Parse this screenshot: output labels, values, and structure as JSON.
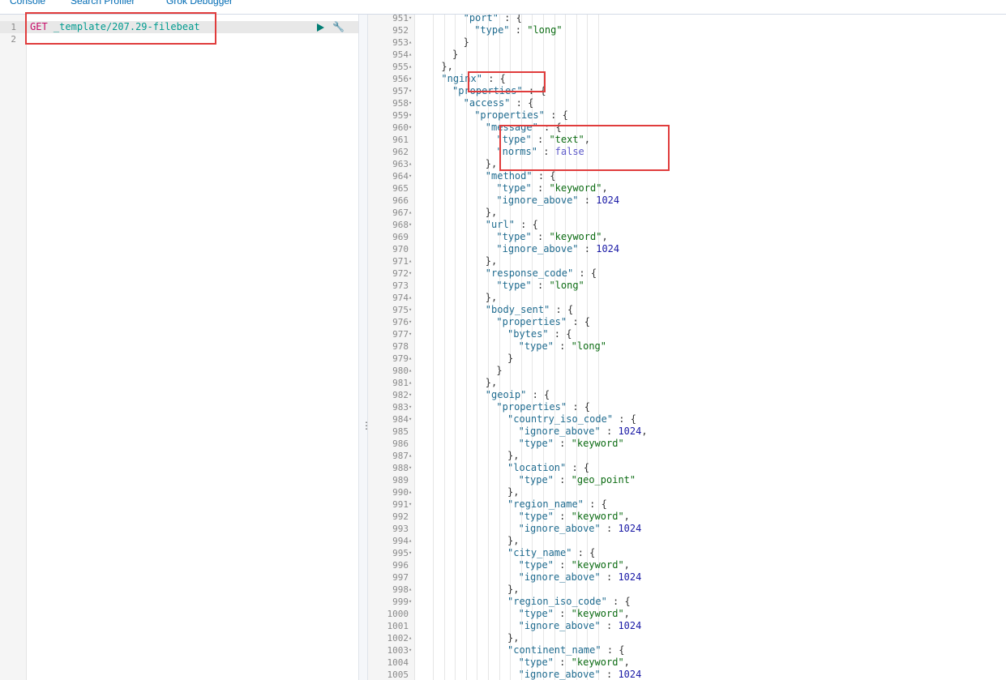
{
  "tabs": [
    "Console",
    "Search Profiler",
    "Grok Debugger"
  ],
  "request": {
    "line_numbers": [
      "1",
      "2"
    ],
    "method": "GET",
    "url": "_template/207.29-filebeat"
  },
  "response": {
    "lines": [
      {
        "n": "951",
        "f": "▾",
        "i": 11,
        "c": [
          [
            "k",
            "\"port\""
          ],
          [
            "p",
            " : {"
          ]
        ]
      },
      {
        "n": "952",
        "f": "",
        "i": 12,
        "c": [
          [
            "k",
            "\"type\""
          ],
          [
            "p",
            " : "
          ],
          [
            "s",
            "\"long\""
          ]
        ]
      },
      {
        "n": "953",
        "f": "▴",
        "i": 11,
        "c": [
          [
            "p",
            "}"
          ]
        ]
      },
      {
        "n": "954",
        "f": "▴",
        "i": 10,
        "c": [
          [
            "p",
            "}"
          ]
        ]
      },
      {
        "n": "955",
        "f": "▴",
        "i": 9,
        "c": [
          [
            "p",
            "},"
          ]
        ]
      },
      {
        "n": "956",
        "f": "▾",
        "i": 9,
        "c": [
          [
            "k",
            "\"nginx\""
          ],
          [
            "p",
            " : {"
          ]
        ]
      },
      {
        "n": "957",
        "f": "▾",
        "i": 10,
        "c": [
          [
            "k",
            "\"properties\""
          ],
          [
            "p",
            " : {"
          ]
        ]
      },
      {
        "n": "958",
        "f": "▾",
        "i": 11,
        "c": [
          [
            "k",
            "\"access\""
          ],
          [
            "p",
            " : {"
          ]
        ]
      },
      {
        "n": "959",
        "f": "▾",
        "i": 12,
        "c": [
          [
            "k",
            "\"properties\""
          ],
          [
            "p",
            " : {"
          ]
        ]
      },
      {
        "n": "960",
        "f": "▾",
        "i": 13,
        "c": [
          [
            "k",
            "\"message\""
          ],
          [
            "p",
            " : {"
          ]
        ]
      },
      {
        "n": "961",
        "f": "",
        "i": 14,
        "c": [
          [
            "k",
            "\"type\""
          ],
          [
            "p",
            " : "
          ],
          [
            "s",
            "\"text\""
          ],
          [
            "p",
            ","
          ]
        ]
      },
      {
        "n": "962",
        "f": "",
        "i": 14,
        "c": [
          [
            "k",
            "\"norms\""
          ],
          [
            "p",
            " : "
          ],
          [
            "b",
            "false"
          ]
        ]
      },
      {
        "n": "963",
        "f": "▴",
        "i": 13,
        "c": [
          [
            "p",
            "},"
          ]
        ]
      },
      {
        "n": "964",
        "f": "▾",
        "i": 13,
        "c": [
          [
            "k",
            "\"method\""
          ],
          [
            "p",
            " : {"
          ]
        ]
      },
      {
        "n": "965",
        "f": "",
        "i": 14,
        "c": [
          [
            "k",
            "\"type\""
          ],
          [
            "p",
            " : "
          ],
          [
            "s",
            "\"keyword\""
          ],
          [
            "p",
            ","
          ]
        ]
      },
      {
        "n": "966",
        "f": "",
        "i": 14,
        "c": [
          [
            "k",
            "\"ignore_above\""
          ],
          [
            "p",
            " : "
          ],
          [
            "n",
            "1024"
          ]
        ]
      },
      {
        "n": "967",
        "f": "▴",
        "i": 13,
        "c": [
          [
            "p",
            "},"
          ]
        ]
      },
      {
        "n": "968",
        "f": "▾",
        "i": 13,
        "c": [
          [
            "k",
            "\"url\""
          ],
          [
            "p",
            " : {"
          ]
        ]
      },
      {
        "n": "969",
        "f": "",
        "i": 14,
        "c": [
          [
            "k",
            "\"type\""
          ],
          [
            "p",
            " : "
          ],
          [
            "s",
            "\"keyword\""
          ],
          [
            "p",
            ","
          ]
        ]
      },
      {
        "n": "970",
        "f": "",
        "i": 14,
        "c": [
          [
            "k",
            "\"ignore_above\""
          ],
          [
            "p",
            " : "
          ],
          [
            "n",
            "1024"
          ]
        ]
      },
      {
        "n": "971",
        "f": "▴",
        "i": 13,
        "c": [
          [
            "p",
            "},"
          ]
        ]
      },
      {
        "n": "972",
        "f": "▾",
        "i": 13,
        "c": [
          [
            "k",
            "\"response_code\""
          ],
          [
            "p",
            " : {"
          ]
        ]
      },
      {
        "n": "973",
        "f": "",
        "i": 14,
        "c": [
          [
            "k",
            "\"type\""
          ],
          [
            "p",
            " : "
          ],
          [
            "s",
            "\"long\""
          ]
        ]
      },
      {
        "n": "974",
        "f": "▴",
        "i": 13,
        "c": [
          [
            "p",
            "},"
          ]
        ]
      },
      {
        "n": "975",
        "f": "▾",
        "i": 13,
        "c": [
          [
            "k",
            "\"body_sent\""
          ],
          [
            "p",
            " : {"
          ]
        ]
      },
      {
        "n": "976",
        "f": "▾",
        "i": 14,
        "c": [
          [
            "k",
            "\"properties\""
          ],
          [
            "p",
            " : {"
          ]
        ]
      },
      {
        "n": "977",
        "f": "▾",
        "i": 15,
        "c": [
          [
            "k",
            "\"bytes\""
          ],
          [
            "p",
            " : {"
          ]
        ]
      },
      {
        "n": "978",
        "f": "",
        "i": 16,
        "c": [
          [
            "k",
            "\"type\""
          ],
          [
            "p",
            " : "
          ],
          [
            "s",
            "\"long\""
          ]
        ]
      },
      {
        "n": "979",
        "f": "▴",
        "i": 15,
        "c": [
          [
            "p",
            "}"
          ]
        ]
      },
      {
        "n": "980",
        "f": "▴",
        "i": 14,
        "c": [
          [
            "p",
            "}"
          ]
        ]
      },
      {
        "n": "981",
        "f": "▴",
        "i": 13,
        "c": [
          [
            "p",
            "},"
          ]
        ]
      },
      {
        "n": "982",
        "f": "▾",
        "i": 13,
        "c": [
          [
            "k",
            "\"geoip\""
          ],
          [
            "p",
            " : {"
          ]
        ]
      },
      {
        "n": "983",
        "f": "▾",
        "i": 14,
        "c": [
          [
            "k",
            "\"properties\""
          ],
          [
            "p",
            " : {"
          ]
        ]
      },
      {
        "n": "984",
        "f": "▾",
        "i": 15,
        "c": [
          [
            "k",
            "\"country_iso_code\""
          ],
          [
            "p",
            " : {"
          ]
        ]
      },
      {
        "n": "985",
        "f": "",
        "i": 16,
        "c": [
          [
            "k",
            "\"ignore_above\""
          ],
          [
            "p",
            " : "
          ],
          [
            "n",
            "1024"
          ],
          [
            "p",
            ","
          ]
        ]
      },
      {
        "n": "986",
        "f": "",
        "i": 16,
        "c": [
          [
            "k",
            "\"type\""
          ],
          [
            "p",
            " : "
          ],
          [
            "s",
            "\"keyword\""
          ]
        ]
      },
      {
        "n": "987",
        "f": "▴",
        "i": 15,
        "c": [
          [
            "p",
            "},"
          ]
        ]
      },
      {
        "n": "988",
        "f": "▾",
        "i": 15,
        "c": [
          [
            "k",
            "\"location\""
          ],
          [
            "p",
            " : {"
          ]
        ]
      },
      {
        "n": "989",
        "f": "",
        "i": 16,
        "c": [
          [
            "k",
            "\"type\""
          ],
          [
            "p",
            " : "
          ],
          [
            "s",
            "\"geo_point\""
          ]
        ]
      },
      {
        "n": "990",
        "f": "▴",
        "i": 15,
        "c": [
          [
            "p",
            "},"
          ]
        ]
      },
      {
        "n": "991",
        "f": "▾",
        "i": 15,
        "c": [
          [
            "k",
            "\"region_name\""
          ],
          [
            "p",
            " : {"
          ]
        ]
      },
      {
        "n": "992",
        "f": "",
        "i": 16,
        "c": [
          [
            "k",
            "\"type\""
          ],
          [
            "p",
            " : "
          ],
          [
            "s",
            "\"keyword\""
          ],
          [
            "p",
            ","
          ]
        ]
      },
      {
        "n": "993",
        "f": "",
        "i": 16,
        "c": [
          [
            "k",
            "\"ignore_above\""
          ],
          [
            "p",
            " : "
          ],
          [
            "n",
            "1024"
          ]
        ]
      },
      {
        "n": "994",
        "f": "▴",
        "i": 15,
        "c": [
          [
            "p",
            "},"
          ]
        ]
      },
      {
        "n": "995",
        "f": "▾",
        "i": 15,
        "c": [
          [
            "k",
            "\"city_name\""
          ],
          [
            "p",
            " : {"
          ]
        ]
      },
      {
        "n": "996",
        "f": "",
        "i": 16,
        "c": [
          [
            "k",
            "\"type\""
          ],
          [
            "p",
            " : "
          ],
          [
            "s",
            "\"keyword\""
          ],
          [
            "p",
            ","
          ]
        ]
      },
      {
        "n": "997",
        "f": "",
        "i": 16,
        "c": [
          [
            "k",
            "\"ignore_above\""
          ],
          [
            "p",
            " : "
          ],
          [
            "n",
            "1024"
          ]
        ]
      },
      {
        "n": "998",
        "f": "▴",
        "i": 15,
        "c": [
          [
            "p",
            "},"
          ]
        ]
      },
      {
        "n": "999",
        "f": "▾",
        "i": 15,
        "c": [
          [
            "k",
            "\"region_iso_code\""
          ],
          [
            "p",
            " : {"
          ]
        ]
      },
      {
        "n": "1000",
        "f": "",
        "i": 16,
        "c": [
          [
            "k",
            "\"type\""
          ],
          [
            "p",
            " : "
          ],
          [
            "s",
            "\"keyword\""
          ],
          [
            "p",
            ","
          ]
        ]
      },
      {
        "n": "1001",
        "f": "",
        "i": 16,
        "c": [
          [
            "k",
            "\"ignore_above\""
          ],
          [
            "p",
            " : "
          ],
          [
            "n",
            "1024"
          ]
        ]
      },
      {
        "n": "1002",
        "f": "▴",
        "i": 15,
        "c": [
          [
            "p",
            "},"
          ]
        ]
      },
      {
        "n": "1003",
        "f": "▾",
        "i": 15,
        "c": [
          [
            "k",
            "\"continent_name\""
          ],
          [
            "p",
            " : {"
          ]
        ]
      },
      {
        "n": "1004",
        "f": "",
        "i": 16,
        "c": [
          [
            "k",
            "\"type\""
          ],
          [
            "p",
            " : "
          ],
          [
            "s",
            "\"keyword\""
          ],
          [
            "p",
            ","
          ]
        ]
      },
      {
        "n": "1005",
        "f": "",
        "i": 16,
        "c": [
          [
            "k",
            "\"ignore_above\""
          ],
          [
            "p",
            " : "
          ],
          [
            "n",
            "1024"
          ]
        ]
      }
    ]
  },
  "colors": {
    "highlight": "#e03c3c",
    "method": "#c80a68",
    "url": "#009b8f"
  }
}
